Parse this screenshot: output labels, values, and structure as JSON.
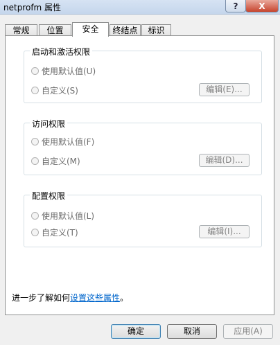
{
  "window": {
    "title": "netprofm 属性",
    "help_label": "?",
    "close_label": "X"
  },
  "tabs": [
    {
      "label": "常规",
      "active": false
    },
    {
      "label": "位置",
      "active": false
    },
    {
      "label": "安全",
      "active": true
    },
    {
      "label": "终结点",
      "active": false
    },
    {
      "label": "标识",
      "active": false
    }
  ],
  "groups": [
    {
      "title": "启动和激活权限",
      "use_default_label": "使用默认值(U)",
      "custom_label": "自定义(S)",
      "edit_label": "编辑(E)..."
    },
    {
      "title": "访问权限",
      "use_default_label": "使用默认值(F)",
      "custom_label": "自定义(M)",
      "edit_label": "编辑(D)..."
    },
    {
      "title": "配置权限",
      "use_default_label": "使用默认值(L)",
      "custom_label": "自定义(T)",
      "edit_label": "编辑(I)..."
    }
  ],
  "footer": {
    "prefix": "进一步了解如何",
    "link": "设置这些属性",
    "suffix": "。"
  },
  "buttons": {
    "ok": "确定",
    "cancel": "取消",
    "apply": "应用(A)"
  }
}
